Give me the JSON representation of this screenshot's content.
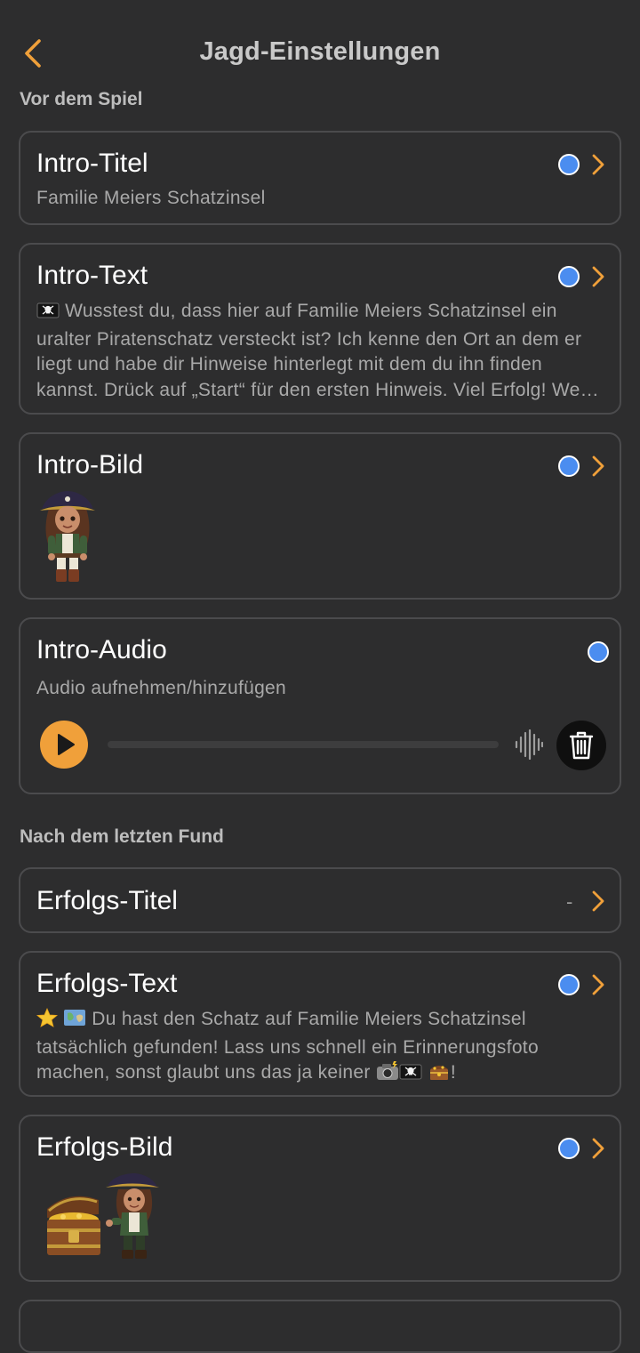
{
  "header": {
    "title": "Jagd-Einstellungen"
  },
  "sections": {
    "before_game": "Vor dem Spiel",
    "after_last_find": "Nach dem letzten Fund"
  },
  "intro_title": {
    "label": "Intro-Titel",
    "value": "Familie Meiers Schatzinsel"
  },
  "intro_text": {
    "label": "Intro-Text",
    "value": "Wusstest du, dass hier auf Familie Meiers Schatzinsel ein uralter Piratenschatz versteckt ist? Ich kenne den Ort an dem er liegt und habe dir Hinweise hinterlegt mit dem du ihn finden kannst. Drück auf „Start“ für den ersten Hinweis. Viel Erfolg! Wenn du nicht weiterkommst, schau dir den Hinweis noch einmal genau an."
  },
  "intro_image": {
    "label": "Intro-Bild"
  },
  "intro_audio": {
    "label": "Intro-Audio",
    "hint": "Audio aufnehmen/hinzufügen",
    "progress": 0
  },
  "success_title": {
    "label": "Erfolgs-Titel",
    "value": "-"
  },
  "success_text": {
    "label": "Erfolgs-Text",
    "part1": "Du hast den Schatz auf Familie Meiers Schatzinsel tatsächlich gefunden! Lass uns schnell ein Erinnerungsfoto machen, sonst glaubt uns das ja keiner",
    "part2": "!"
  },
  "success_image": {
    "label": "Erfolgs-Bild"
  },
  "colors": {
    "background": "#2d2d2e",
    "accent": "#f0a03a",
    "status_dot": "#4b8df0",
    "card_border": "#4b4b4d",
    "secondary_text": "#a9a9a9"
  },
  "icons": {
    "back": "chevron-left-icon",
    "row_arrow": "chevron-right-icon",
    "status": "blue-dot-icon",
    "play": "play-icon",
    "waveform": "waveform-icon",
    "delete": "trash-icon",
    "pirate_flag": "pirate-flag-emoji",
    "star": "star-emoji",
    "map": "map-emoji",
    "camera": "camera-flash-emoji",
    "treasure": "treasure-emoji"
  }
}
